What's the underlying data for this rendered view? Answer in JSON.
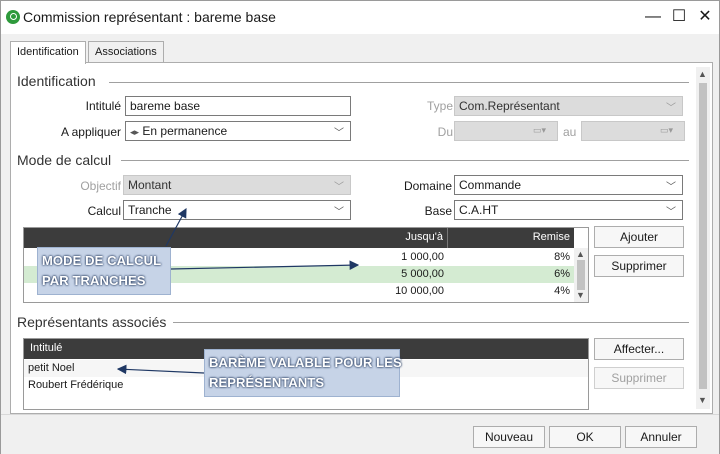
{
  "window": {
    "title": "Commission représentant :  bareme base",
    "minimize_glyph": "—",
    "maximize_glyph": "☐",
    "close_glyph": "✕"
  },
  "tabs": [
    {
      "label": "Identification",
      "active": true
    },
    {
      "label": "Associations",
      "active": false
    }
  ],
  "identification": {
    "section_title": "Identification",
    "intitule_label": "Intitulé",
    "intitule_value": "bareme base",
    "type_label": "Type",
    "type_value": "Com.Représentant",
    "appliquer_label": "A appliquer",
    "appliquer_value": "En permanence",
    "du_label": "Du",
    "au_label": "au"
  },
  "mode_calcul": {
    "section_title": "Mode de calcul",
    "objectif_label": "Objectif",
    "objectif_value": "Montant",
    "domaine_label": "Domaine",
    "domaine_value": "Commande",
    "calcul_label": "Calcul",
    "calcul_value": "Tranche",
    "base_label": "Base",
    "base_value": "C.A.HT",
    "columns": [
      "Jusqu'à",
      "Remise"
    ],
    "rows": [
      {
        "jusqua": "1 000,00",
        "remise": "8%"
      },
      {
        "jusqua": "5 000,00",
        "remise": "6%"
      },
      {
        "jusqua": "10 000,00",
        "remise": "4%"
      }
    ],
    "ajouter_label": "Ajouter",
    "supprimer_label": "Supprimer"
  },
  "representants": {
    "section_title": "Représentants associés",
    "column": "Intitulé",
    "rows": [
      "petit Noel",
      "Roubert Frédérique"
    ],
    "affecter_label": "Affecter...",
    "supprimer_label": "Supprimer"
  },
  "callouts": {
    "mode_line1": "MODE DE CALCUL",
    "mode_line2": "PAR TRANCHES",
    "bareme_line1": "BARÈME VALABLE POUR LES",
    "bareme_line2": "REPRÉSENTANTS"
  },
  "footer": {
    "nouveau_label": "Nouveau",
    "ok_label": "OK",
    "annuler_label": "Annuler"
  },
  "colors": {
    "selected_row": "#d4ebd2",
    "grid_header": "#3c3c3c",
    "callout_bg": "#c6d3e7",
    "arrow": "#1f3864",
    "app_icon": "#2e9a3c"
  }
}
